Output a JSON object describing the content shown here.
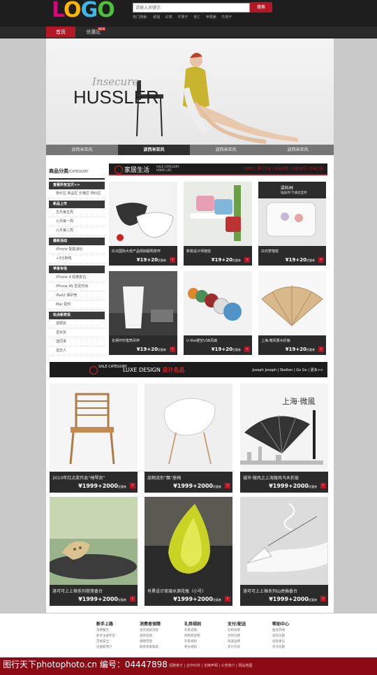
{
  "header": {
    "logo": [
      "L",
      "O",
      "G",
      "O"
    ],
    "search_placeholder": "请输入关键字",
    "search_button": "搜索",
    "hot_label": "热门搜索:",
    "hot_terms": [
      "纸钱",
      "红枣",
      "芒果干",
      "杏仁",
      "苹果脆",
      "牛肉干"
    ]
  },
  "nav": {
    "home": "首页",
    "promo": "优惠区",
    "badge": "NEW"
  },
  "banner": {
    "subtitle": "Insecure",
    "title": "HUSSLER",
    "tabs": [
      "波西米亚风",
      "波西米亚风",
      "波西米亚风",
      "波西米亚风"
    ],
    "active_tab": 1
  },
  "sidebar": {
    "title": "商品分类",
    "title_en": "/CATEGORY",
    "groups": [
      {
        "head": "查看所有宝贝>>",
        "items": [
          "特价区 新品区 价格区 特价区"
        ]
      },
      {
        "head": "新品上市",
        "items": [
          "五月第五周",
          "六月第一周",
          "六月第二周"
        ]
      },
      {
        "head": "最新活动",
        "items": [
          "iPhone 配配减价",
          "+3元换购"
        ]
      },
      {
        "head": "苹果专场",
        "items": [
          "iPhone 4 经典复古",
          "iPhone 4S 至爱时尚",
          "iPad2 保护壳",
          "Mac 配件"
        ]
      },
      {
        "head": "玩点新奇货",
        "items": [
          "送朋友",
          "送女友",
          "送同事",
          "送恋人"
        ]
      }
    ]
  },
  "section1": {
    "title": "家居生活",
    "en": [
      "SALE CATEGORY",
      "HOME LIFE"
    ],
    "links": "东西坊 | 厨门文化 | 玩品家居 | 创意宝贝 | 艺术之源"
  },
  "section2": {
    "title_a": "LUXE DESIGN",
    "title_b": "设计名品",
    "en": "SALE CATEGORY",
    "links": "Joseph Joseph | Skelton | Go Go | 更多>>"
  },
  "home_products": [
    {
      "name": "红点国际大奖产品倾斜聪明茶杯",
      "price": "¥19+20",
      "tag": "优惠券"
    },
    {
      "name": "新锐设计师抱枕",
      "price": "¥19+20",
      "tag": "优惠券"
    },
    {
      "name": "白日梦抱枕",
      "price": "¥19+20",
      "tag": "优惠券",
      "label_a": "梁科林",
      "label_b": "插画师/卡通造型师"
    },
    {
      "name": "长柄环形笔筒吊杯",
      "price": "¥19+20",
      "tag": "优惠券"
    },
    {
      "name": "U-like镂空USB风扇",
      "price": "¥19+20",
      "tag": "优惠券"
    },
    {
      "name": "上海·微风香木折扇",
      "price": "¥19+20",
      "tag": "优惠券"
    }
  ],
  "design_products": [
    {
      "name": "2010年红点奖作品“椅琴剑”",
      "price": "¥1999+2000",
      "tag": "优惠券"
    },
    {
      "name": "品物流形“飘”座椅",
      "price": "¥1999+2000",
      "tag": "优惠券"
    },
    {
      "name": "城市·微风之上海微风乌木折扇",
      "price": "¥1999+2000",
      "tag": "优惠券",
      "overlay": "上海·微風"
    },
    {
      "name": "洛可可上上禅系列荷莲香台",
      "price": "¥1999+2000",
      "tag": "优惠券"
    },
    {
      "name": "肖勇设计琉璃水滴花瓶（小号）",
      "price": "¥1999+2000",
      "tag": "优惠券"
    },
    {
      "name": "洛可可上上禅系列山虎插香台",
      "price": "¥1999+2000",
      "tag": "优惠券"
    }
  ],
  "footer": {
    "columns": [
      {
        "head": "新手上路",
        "items": [
          "消费警示",
          "新手注册专区",
          "交易安全",
          "注册新用户"
        ]
      },
      {
        "head": "消费者保障",
        "items": [
          "退货退款流程",
          "退款说明",
          "保障范围",
          "联系客服帮助"
        ]
      },
      {
        "head": "礼券规则",
        "items": [
          "礼券说明",
          "购物券说明",
          "礼券规则",
          "积分规则"
        ]
      },
      {
        "head": "支付/配送",
        "items": [
          "包邮说明",
          "货到付款",
          "快递运费",
          "支付方式"
        ]
      },
      {
        "head": "帮助中心",
        "items": [
          "服务热线",
          "常见问题",
          "投诉建议",
          "热点问题"
        ]
      }
    ],
    "links": "招聘英才 | 合作伙伴 | 法律声明 | 公司简介 | 网站地图",
    "watermark": "图行天下photophoto.cn    编号：04447898"
  }
}
